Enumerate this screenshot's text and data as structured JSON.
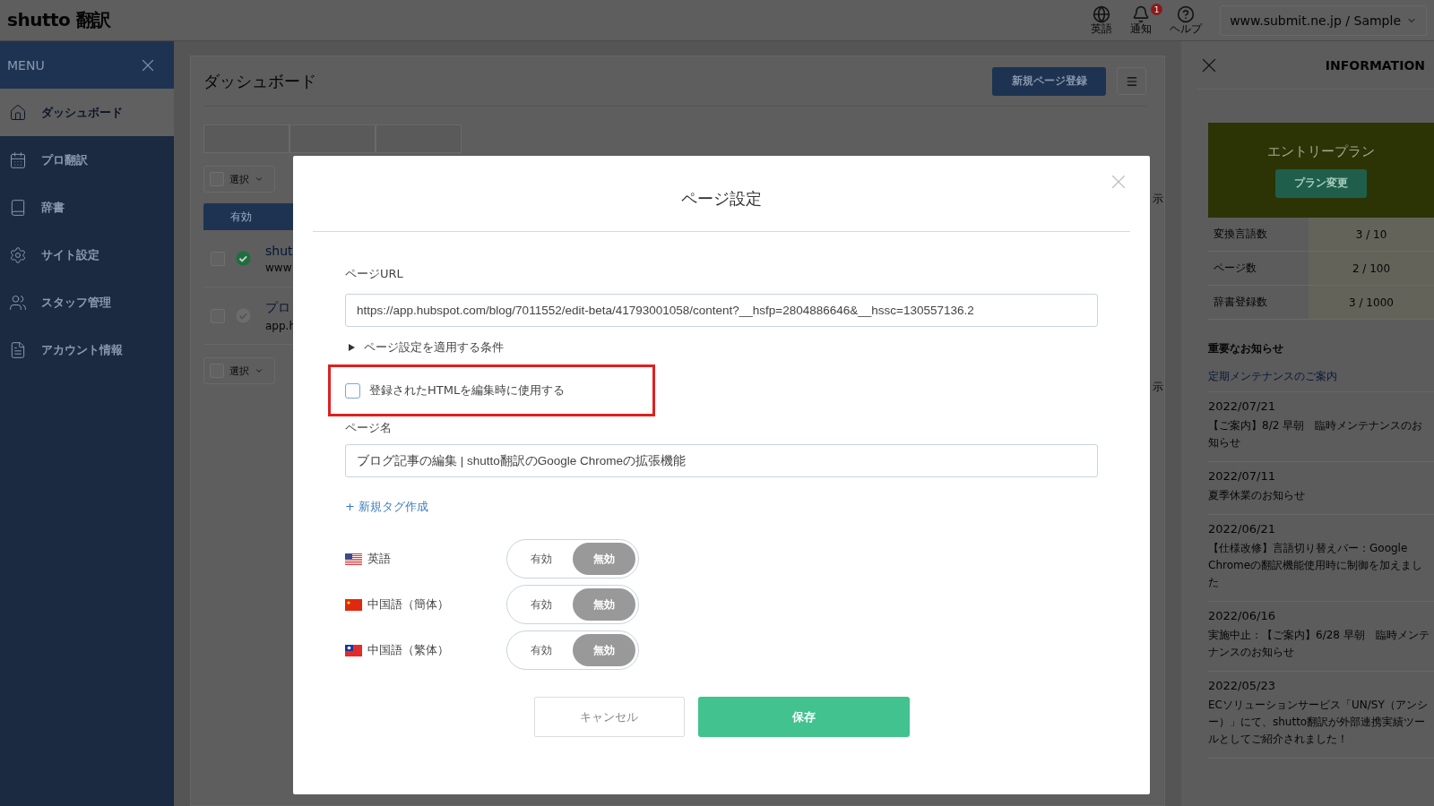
{
  "topbar": {
    "logo": "shutto 翻訳",
    "actions": [
      {
        "label": "英語"
      },
      {
        "label": "通知",
        "badge": "1"
      },
      {
        "label": "ヘルプ"
      }
    ],
    "site_selector": "www.submit.ne.jp / Sample"
  },
  "sidebar": {
    "title": "MENU",
    "items": [
      {
        "label": "ダッシュボード",
        "selected": true
      },
      {
        "label": "プロ翻訳",
        "selected": false
      },
      {
        "label": "辞書",
        "selected": false
      },
      {
        "label": "サイト設定",
        "selected": false
      },
      {
        "label": "スタッフ管理",
        "selected": false
      },
      {
        "label": "アカウント情報",
        "selected": false
      }
    ]
  },
  "dashboard": {
    "title": "ダッシュボード",
    "new_page_button": "新規ページ登録",
    "select_dropdowns": [
      "選択",
      "選択"
    ],
    "table_header": "有効",
    "rows": [
      {
        "title": "shut",
        "url": "www",
        "checked": false,
        "published": true
      },
      {
        "title": "プロ",
        "url": "app.h",
        "checked": false,
        "published": false
      }
    ],
    "edge_texts": [
      "示",
      "示"
    ]
  },
  "information": {
    "title": "INFORMATION",
    "plan": {
      "name": "エントリープラン",
      "button": "プラン変更"
    },
    "stats": [
      {
        "label": "変換言語数",
        "value": "3 / 10"
      },
      {
        "label": "ページ数",
        "value": "2 / 100"
      },
      {
        "label": "辞書登録数",
        "value": "3 / 1000"
      }
    ],
    "notices_title": "重要なお知らせ",
    "notices_link": "定期メンテナンスのご案内",
    "news": [
      {
        "date": "2022/07/21",
        "text": "【ご案内】8/2 早朝　臨時メンテナンスのお知らせ"
      },
      {
        "date": "2022/07/11",
        "text": "夏季休業のお知らせ"
      },
      {
        "date": "2022/06/21",
        "text": "【仕様改修】言語切り替えバー：Google Chromeの翻訳機能使用時に制御を加えました"
      },
      {
        "date": "2022/06/16",
        "text": "実施中止：【ご案内】6/28 早朝　臨時メンテナンスのお知らせ"
      },
      {
        "date": "2022/05/23",
        "text": "ECソリューションサービス「UN/SY（アンシー）」にて、shutto翻訳が外部連携実績ツールとしてご紹介されました！"
      }
    ]
  },
  "modal": {
    "title": "ページ設定",
    "url_label": "ページURL",
    "url_value": "https://app.hubspot.com/blog/7011552/edit-beta/41793001058/content?__hsfp=2804886646&__hssc=130557136.2",
    "conditions": {
      "label": "ページ設定を適用する条件",
      "expanded": false
    },
    "use_html": {
      "label": "登録されたHTMLを編集時に使用する",
      "checked": false,
      "highlighted": true
    },
    "name_label": "ページ名",
    "name_value": "ブログ記事の編集 | shutto翻訳のGoogle Chromeの拡張機能",
    "new_tag_link": "+ 新規タグ作成",
    "languages": [
      {
        "name": "英語",
        "kind": "us",
        "options": [
          {
            "label": "有効",
            "selected": false
          },
          {
            "label": "無効",
            "selected": true
          }
        ]
      },
      {
        "name": "中国語（簡体）",
        "kind": "cn",
        "options": [
          {
            "label": "有効",
            "selected": false
          },
          {
            "label": "無効",
            "selected": true
          }
        ]
      },
      {
        "name": "中国語（繁体）",
        "kind": "tw",
        "options": [
          {
            "label": "有効",
            "selected": false
          },
          {
            "label": "無効",
            "selected": true
          }
        ]
      }
    ],
    "cancel_button": "キャンセル",
    "save_button": "保存"
  }
}
